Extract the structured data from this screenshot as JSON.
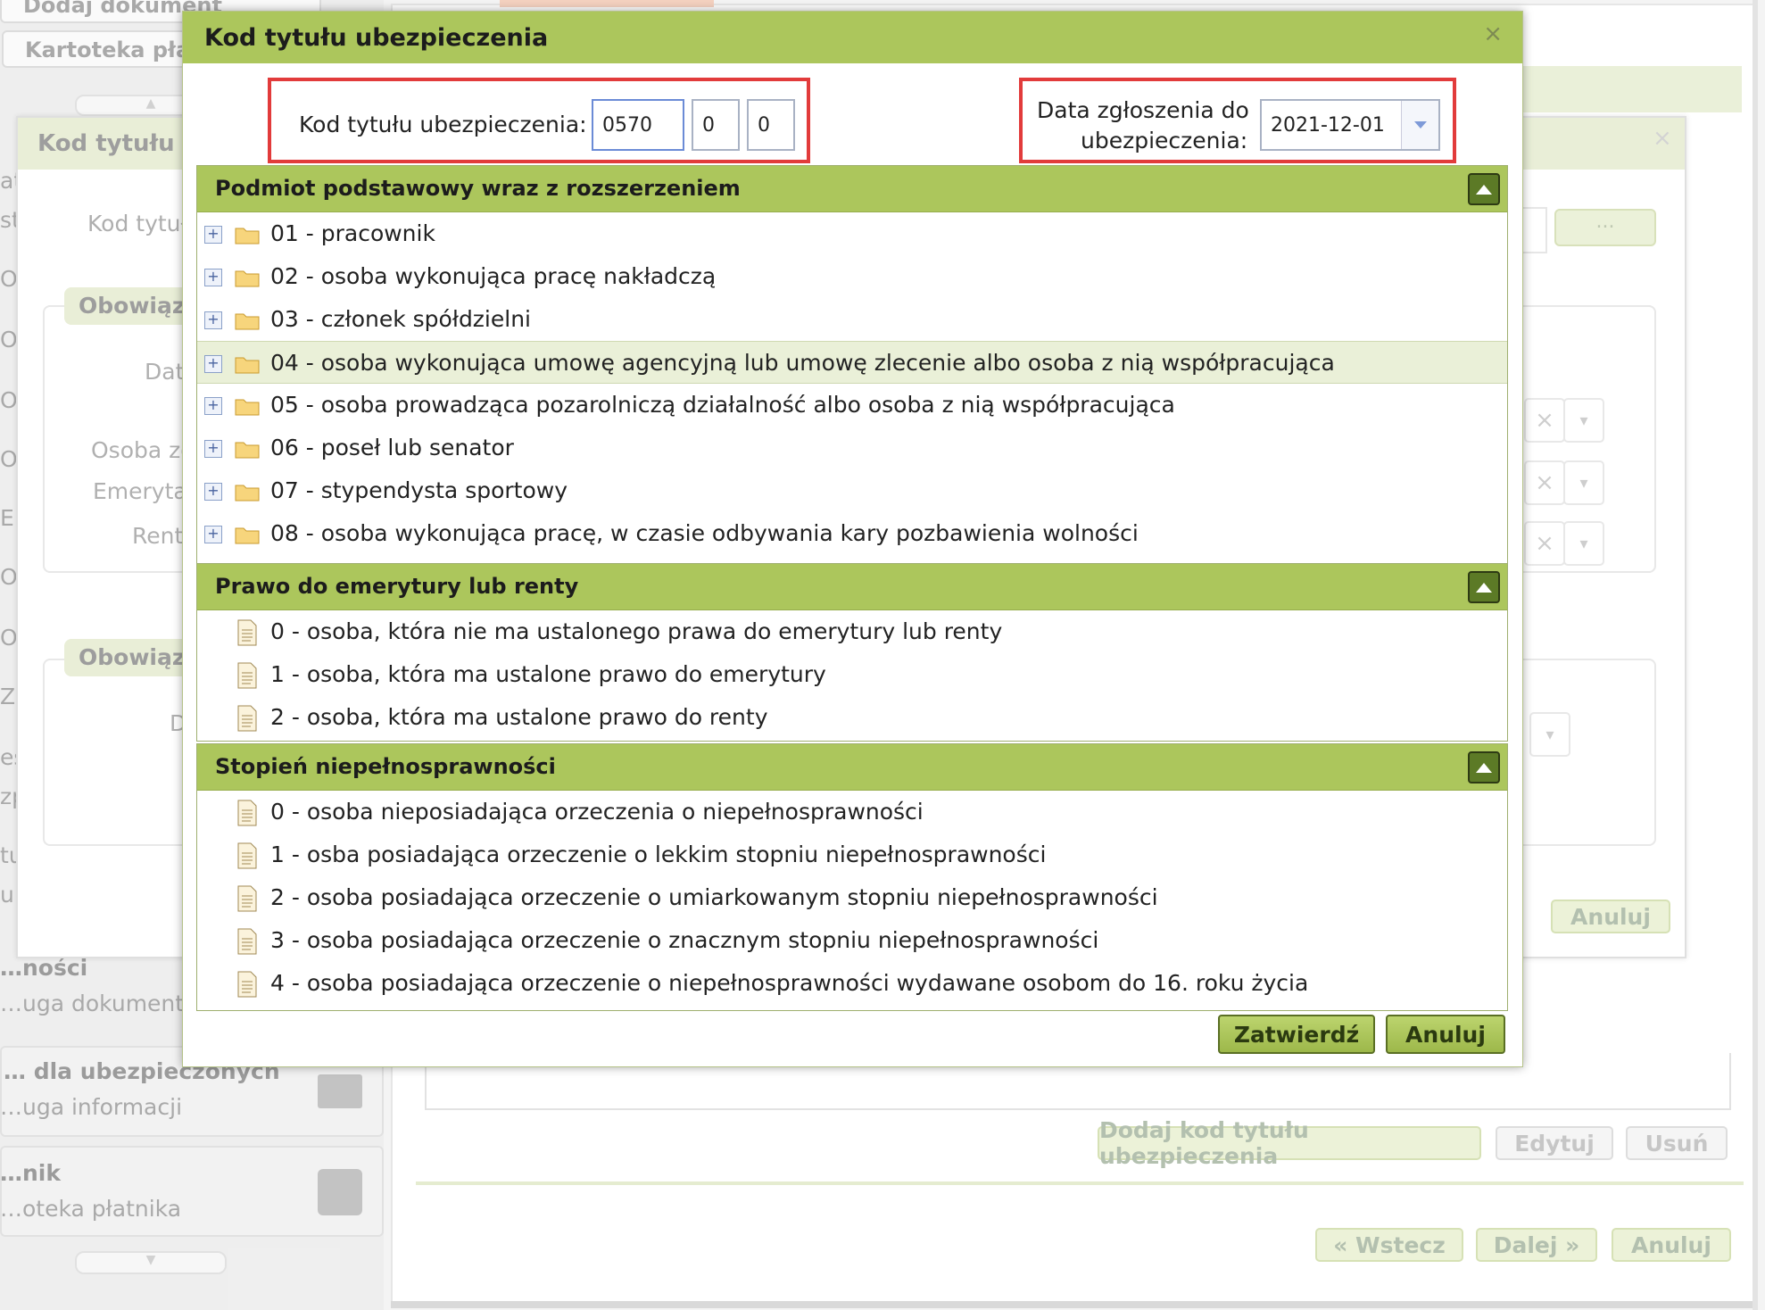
{
  "background": {
    "sidebar": {
      "btn_add_doc": "Dodaj dokument",
      "btn_kartoteka": "Kartoteka pła",
      "section1_title": "…ności",
      "section1_sub": "…uga dokumentów",
      "section2_title": "… dla ubezpieczonych",
      "section2_sub": "…uga informacji",
      "section3_title": "…nik",
      "section3_sub": "…oteka płatnika"
    },
    "dialog": {
      "title": "Kod tytułu u",
      "field_label": "Kod tytuł",
      "group1": "Obowiąz",
      "row_dat": "Dat",
      "row_osoba": "Osoba zg",
      "row_emeryt": "Emerytal",
      "row_rent": "Rent",
      "group2": "Obowiąz",
      "row_d": "D",
      "browse": "...",
      "cancel": "Anuluj"
    },
    "panel": {
      "add_code": "Dodaj kod tytułu ubezpieczenia",
      "edit": "Edytuj",
      "delete": "Usuń",
      "back": "« Wstecz",
      "next": "Dalej »",
      "cancel": "Anuluj"
    },
    "left_letters": [
      "at",
      "st",
      "Ol",
      "Ol",
      "Ol",
      "Ol",
      "En",
      "Ol",
      "Ol",
      "Zg",
      "es",
      "zp",
      "tu",
      "ur"
    ]
  },
  "modal": {
    "title": "Kod tytułu ubezpieczenia",
    "close": "×",
    "code_label": "Kod tytułu ubezpieczenia:",
    "code_values": [
      "0570",
      "0",
      "0"
    ],
    "date_label_1": "Data zgłoszenia do",
    "date_label_2": "ubezpieczenia:",
    "date_value": "2021-12-01",
    "sections": [
      {
        "title": "Podmiot podstawowy wraz z rozszerzeniem",
        "items": [
          "01 - pracownik",
          "02 - osoba wykonująca pracę nakładczą",
          "03 - członek spółdzielni",
          "04 - osoba wykonująca umowę agencyjną lub umowę zlecenie albo osoba z nią współpracująca",
          "05 - osoba prowadząca pozarolniczą działalność albo osoba z nią współpracująca",
          "06 - poseł lub senator",
          "07 - stypendysta sportowy",
          "08 - osoba wykonująca pracę, w czasie odbywania kary pozbawienia wolności"
        ]
      },
      {
        "title": "Prawo do emerytury lub renty",
        "items": [
          "0 - osoba, która nie ma ustalonego prawa do emerytury lub renty",
          "1 - osoba, która ma ustalone prawo do emerytury",
          "2 - osoba, która ma ustalone prawo do renty"
        ]
      },
      {
        "title": "Stopień niepełnosprawności",
        "items": [
          "0 - osoba nieposiadająca orzeczenia o niepełnosprawności",
          "1 - osba posiadająca orzeczenie o lekkim stopniu niepełnosprawności",
          "2 - osoba posiadająca orzeczenie o umiarkowanym stopniu niepełnosprawności",
          "3 - osoba posiadająca orzeczenie o znacznym stopniu niepełnosprawności",
          "4 - osoba posiadająca orzeczenie o niepełnosprawności wydawane osobom do 16. roku życia"
        ]
      }
    ],
    "confirm": "Zatwierdź",
    "cancel": "Anuluj"
  },
  "colors": {
    "header_green": "#acc65c",
    "highlight_red": "#e23b3b",
    "selected_row": "#eaf0d8"
  }
}
